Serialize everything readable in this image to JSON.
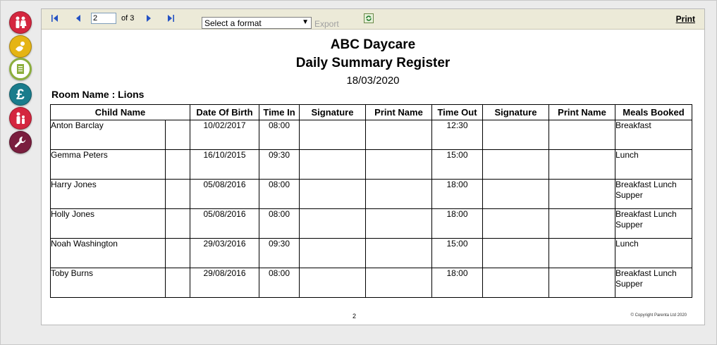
{
  "toolbar": {
    "page_value": "2",
    "page_of": "of 3",
    "format_placeholder": "Select a format",
    "export_label": "Export",
    "print_label": "Print"
  },
  "sidebar_icons": [
    "family-icon",
    "baby-icon",
    "register-icon",
    "pound-icon",
    "child-icon",
    "wrench-icon"
  ],
  "report": {
    "title": "ABC Daycare",
    "subtitle": "Daily Summary Register",
    "date": "18/03/2020",
    "room_label": "Room Name : Lions",
    "columns": [
      "Child Name",
      "Date Of Birth",
      "Time In",
      "Signature",
      "Print Name",
      "Time Out",
      "Signature",
      "Print Name",
      "Meals Booked"
    ],
    "rows": [
      {
        "name": "Anton Barclay",
        "dob": "10/02/2017",
        "time_in": "08:00",
        "time_out": "12:30",
        "meals": "Breakfast"
      },
      {
        "name": "Gemma Peters",
        "dob": "16/10/2015",
        "time_in": "09:30",
        "time_out": "15:00",
        "meals": "Lunch"
      },
      {
        "name": "Harry Jones",
        "dob": "05/08/2016",
        "time_in": "08:00",
        "time_out": "18:00",
        "meals": "Breakfast Lunch Supper"
      },
      {
        "name": "Holly Jones",
        "dob": "05/08/2016",
        "time_in": "08:00",
        "time_out": "18:00",
        "meals": "Breakfast Lunch Supper"
      },
      {
        "name": "Noah Washington",
        "dob": "29/03/2016",
        "time_in": "09:30",
        "time_out": "15:00",
        "meals": "Lunch"
      },
      {
        "name": "Toby Burns",
        "dob": "29/08/2016",
        "time_in": "08:00",
        "time_out": "18:00",
        "meals": "Breakfast Lunch Supper"
      }
    ],
    "page_number": "2",
    "copyright": "© Copyright Parenta Ltd 2020"
  },
  "colors": {
    "toolbar_bg": "#ecead8",
    "icon_red": "#d4263f",
    "icon_yellow": "#e5b414",
    "icon_green": "#8cae3c",
    "icon_teal": "#1a7c8c",
    "icon_maroon": "#7a1e3e",
    "nav_blue": "#2452c4"
  }
}
